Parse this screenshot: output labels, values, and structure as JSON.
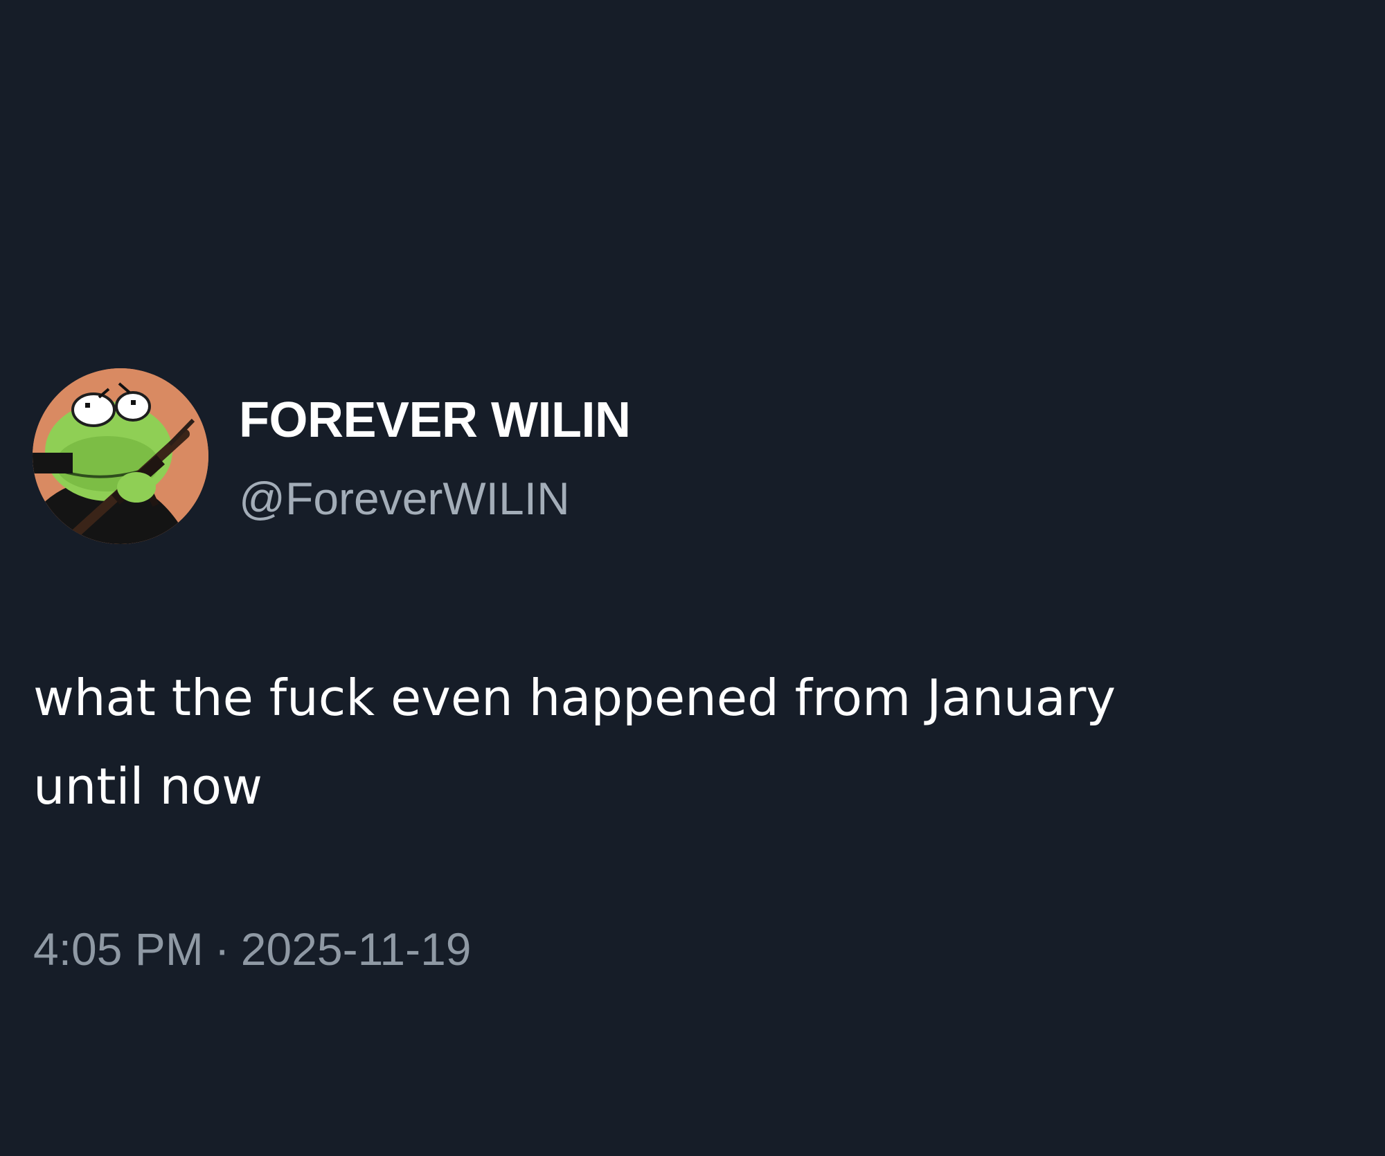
{
  "tweet": {
    "author": {
      "display_name": "FOREVER WILIN",
      "handle": "@ForeverWILIN",
      "avatar_icon": "frog-with-rifle-avatar"
    },
    "text": "what the fuck even happened from January\nuntil now",
    "time": "4:05 PM",
    "separator": "·",
    "date": "2025-11-19"
  },
  "colors": {
    "background": "#161d28",
    "primary_text": "#ffffff",
    "handle_text": "#a3adb8",
    "meta_text": "#8f99a4",
    "avatar_bg": "#d98a62",
    "frog_green": "#8fcf55"
  }
}
